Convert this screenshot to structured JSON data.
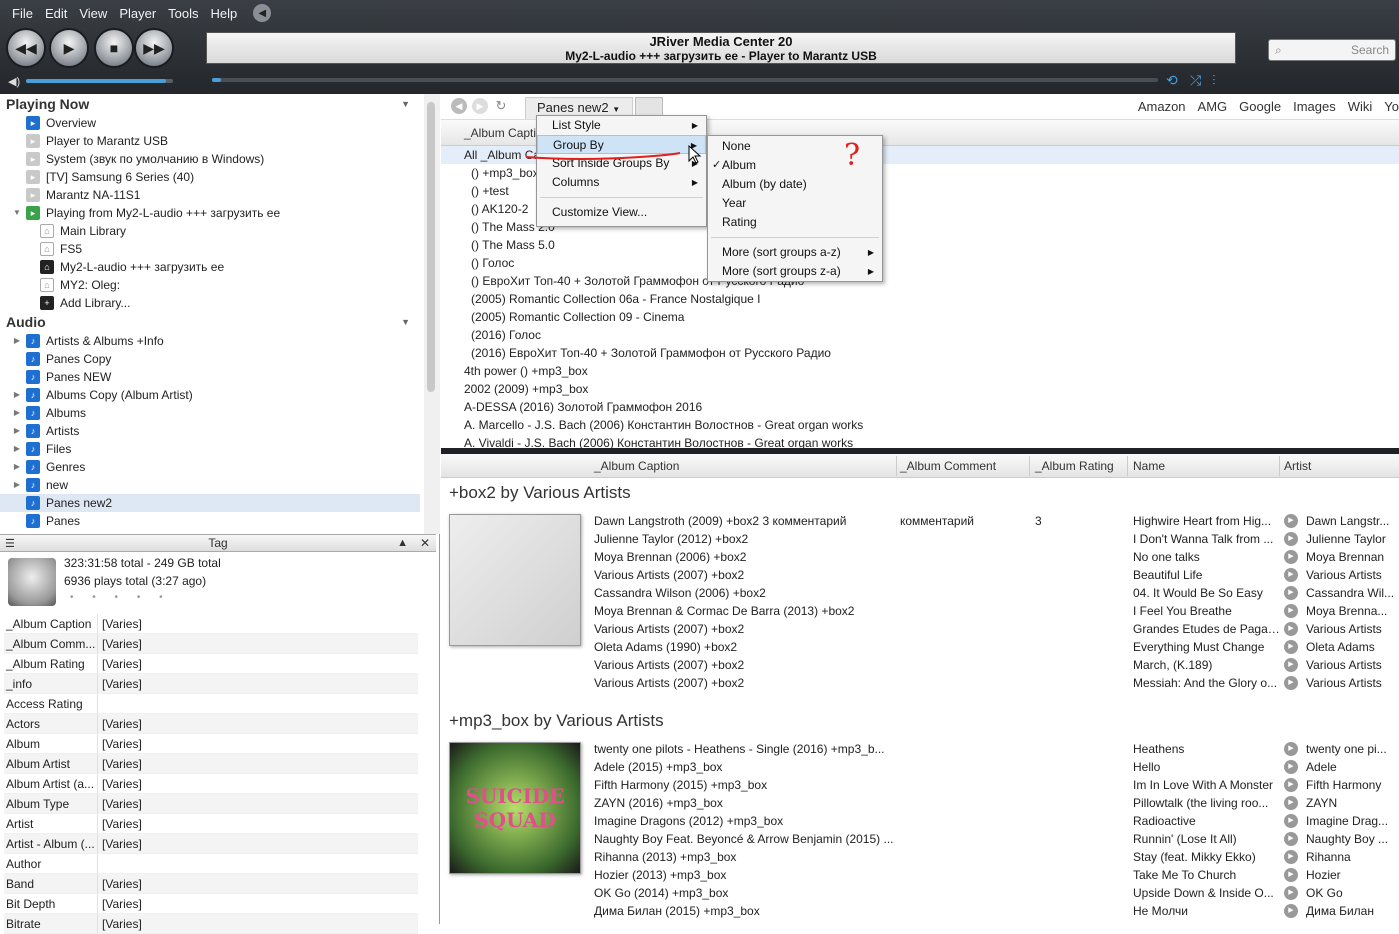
{
  "menubar": {
    "items": [
      "File",
      "Edit",
      "View",
      "Player",
      "Tools",
      "Help"
    ]
  },
  "lcd": {
    "title": "JRiver Media Center 20",
    "subtitle": "My2-L-audio +++ загрузить ее - Player to Marantz USB"
  },
  "search": {
    "placeholder": "Search"
  },
  "playback": {
    "volume_fraction": 0.95,
    "seek_fraction": 0.01
  },
  "tree": {
    "playing_now": {
      "header": "Playing Now",
      "items": [
        "Overview",
        "Player to Marantz USB",
        "System (звук по умолчанию в Windows)",
        "[TV] Samsung 6 Series (40)",
        "Marantz NA-11S1",
        "Playing from My2-L-audio +++ загрузить ее",
        "Main Library",
        "FS5",
        "My2-L-audio +++ загрузить ее",
        "MY2: Oleg:",
        "Add Library..."
      ]
    },
    "audio": {
      "header": "Audio",
      "items": [
        "Artists & Albums +Info",
        "Panes Copy",
        "Panes NEW",
        "Albums Copy (Album Artist)",
        "Albums",
        "Artists",
        "Files",
        "Genres",
        "new",
        "Panes new2",
        "Panes"
      ]
    }
  },
  "tag": {
    "title": "Tag",
    "total_time": "323:31:58 total - 249 GB total",
    "plays": "6936 plays total (3:27 ago)",
    "rating_stars": "• • • • •",
    "props": [
      {
        "k": "_Album Caption",
        "v": "[Varies]"
      },
      {
        "k": "_Album Comm...",
        "v": "[Varies]"
      },
      {
        "k": "_Album Rating",
        "v": "[Varies]"
      },
      {
        "k": "_info",
        "v": "[Varies]"
      },
      {
        "k": "Access Rating",
        "v": ""
      },
      {
        "k": "Actors",
        "v": "[Varies]"
      },
      {
        "k": "Album",
        "v": "[Varies]"
      },
      {
        "k": "Album Artist",
        "v": "[Varies]"
      },
      {
        "k": "Album Artist (a...",
        "v": "[Varies]"
      },
      {
        "k": "Album Type",
        "v": "[Varies]"
      },
      {
        "k": "Artist",
        "v": "[Varies]"
      },
      {
        "k": "Artist - Album (...",
        "v": "[Varies]"
      },
      {
        "k": "Author",
        "v": ""
      },
      {
        "k": "Band",
        "v": "[Varies]"
      },
      {
        "k": "Bit Depth",
        "v": "[Varies]"
      },
      {
        "k": "Bitrate",
        "v": "[Varies]"
      }
    ]
  },
  "view": {
    "tab_label": "Panes new2"
  },
  "links": [
    "Amazon",
    "AMG",
    "Google",
    "Images",
    "Wiki",
    "Yo"
  ],
  "upper": {
    "column": "_Album Caption",
    "rows": [
      "All _Album Caption",
      "() +mp3_box",
      "() +test",
      "() AK120-2",
      "() The Mass 2.0",
      "() The Mass 5.0",
      "() Голос",
      "() ЕвроХит Топ-40 + Золотой Граммофон от Русского Радио",
      "(2005)  Romantic Collection 06a - France Nostalgique I",
      "(2005)  Romantic Collection 09 - Cinema",
      "(2016)  Голос",
      "(2016)  ЕвроХит Топ-40 + Золотой Граммофон от Русского Радио",
      "4th power  ()  +mp3_box",
      "2002  (2009)  +mp3_box",
      "A-DESSA  (2016)  Золотой Граммофон 2016",
      "A. Marcello - J.S. Bach  (2006)  Константин Волостнов - Great organ works",
      "A. Vivaldi - J.S. Bach  (2006)  Константин Волостнов - Great organ works"
    ]
  },
  "lower": {
    "columns": [
      "_Album Caption",
      "_Album Comment",
      "_Album Rating",
      "Name",
      "Artist"
    ],
    "groups": [
      {
        "title": "+box2 by Various Artists",
        "rows": [
          {
            "caption": "Dawn Langstroth  (2009)  +box2    3    комментарий",
            "comment": "комментарий",
            "rating": "3",
            "name": "Highwire Heart from Hig...",
            "artist": "Dawn Langstr..."
          },
          {
            "caption": "Julienne Taylor  (2012)  +box2",
            "comment": "",
            "rating": "",
            "name": "I Don't Wanna Talk from ...",
            "artist": "Julienne Taylor"
          },
          {
            "caption": "Moya Brennan  (2006)  +box2",
            "comment": "",
            "rating": "",
            "name": "No one talks",
            "artist": "Moya Brennan"
          },
          {
            "caption": "Various Artists  (2007)  +box2",
            "comment": "",
            "rating": "",
            "name": "Beautiful Life",
            "artist": "Various Artists"
          },
          {
            "caption": "Cassandra Wilson  (2006)  +box2",
            "comment": "",
            "rating": "",
            "name": "04. It Would Be So Easy",
            "artist": "Cassandra Wil..."
          },
          {
            "caption": "Moya Brennan & Cormac De Barra  (2013)  +box2",
            "comment": "",
            "rating": "",
            "name": "I Feel You Breathe",
            "artist": "Moya Brenna..."
          },
          {
            "caption": "Various Artists  (2007)  +box2",
            "comment": "",
            "rating": "",
            "name": "Grandes Etudes de Pagan...",
            "artist": "Various Artists"
          },
          {
            "caption": "Oleta Adams  (1990)  +box2",
            "comment": "",
            "rating": "",
            "name": "Everything Must Change",
            "artist": "Oleta Adams"
          },
          {
            "caption": "Various Artists  (2007)  +box2",
            "comment": "",
            "rating": "",
            "name": "March, (K.189)",
            "artist": "Various Artists"
          },
          {
            "caption": "Various Artists  (2007)  +box2",
            "comment": "",
            "rating": "",
            "name": "Messiah: And the Glory o...",
            "artist": "Various Artists"
          }
        ]
      },
      {
        "title": "+mp3_box by Various Artists",
        "art_text": "SUICIDE SQUAD",
        "rows": [
          {
            "caption": "twenty one pilots - Heathens - Single  (2016)  +mp3_b...",
            "comment": "",
            "rating": "",
            "name": "Heathens",
            "artist": "twenty one pi..."
          },
          {
            "caption": "Adele  (2015)  +mp3_box",
            "comment": "",
            "rating": "",
            "name": "Hello",
            "artist": "Adele"
          },
          {
            "caption": "Fifth Harmony  (2015)  +mp3_box",
            "comment": "",
            "rating": "",
            "name": "Im In Love With A Monster",
            "artist": "Fifth Harmony"
          },
          {
            "caption": "ZAYN  (2016)  +mp3_box",
            "comment": "",
            "rating": "",
            "name": "Pillowtalk (the living roo...",
            "artist": "ZAYN"
          },
          {
            "caption": "Imagine Dragons  (2012)  +mp3_box",
            "comment": "",
            "rating": "",
            "name": "Radioactive",
            "artist": "Imagine Drag..."
          },
          {
            "caption": "Naughty Boy Feat. Beyoncé & Arrow Benjamin  (2015)  ...",
            "comment": "",
            "rating": "",
            "name": "Runnin' (Lose It All)",
            "artist": "Naughty Boy ..."
          },
          {
            "caption": "Rihanna  (2013)  +mp3_box",
            "comment": "",
            "rating": "",
            "name": "Stay (feat. Mikky Ekko)",
            "artist": "Rihanna"
          },
          {
            "caption": "Hozier  (2013)  +mp3_box",
            "comment": "",
            "rating": "",
            "name": "Take Me To Church",
            "artist": "Hozier"
          },
          {
            "caption": "OK Go  (2014)  +mp3_box",
            "comment": "",
            "rating": "",
            "name": "Upside Down & Inside O...",
            "artist": "OK Go"
          },
          {
            "caption": "Дима Билан  (2015)  +mp3_box",
            "comment": "",
            "rating": "",
            "name": "Не Молчи",
            "artist": "Дима Билан"
          }
        ]
      }
    ]
  },
  "menu_view": {
    "items": [
      "List Style",
      "Group By",
      "Sort Inside Groups By",
      "Columns",
      "Customize View..."
    ]
  },
  "menu_groupby": {
    "items": [
      "None",
      "Album",
      "Album (by date)",
      "Year",
      "Rating",
      "More (sort groups a-z)",
      "More (sort groups z-a)"
    ],
    "checked": "Album"
  },
  "annotation": {
    "mark": "?",
    "color": "#e0201c"
  }
}
